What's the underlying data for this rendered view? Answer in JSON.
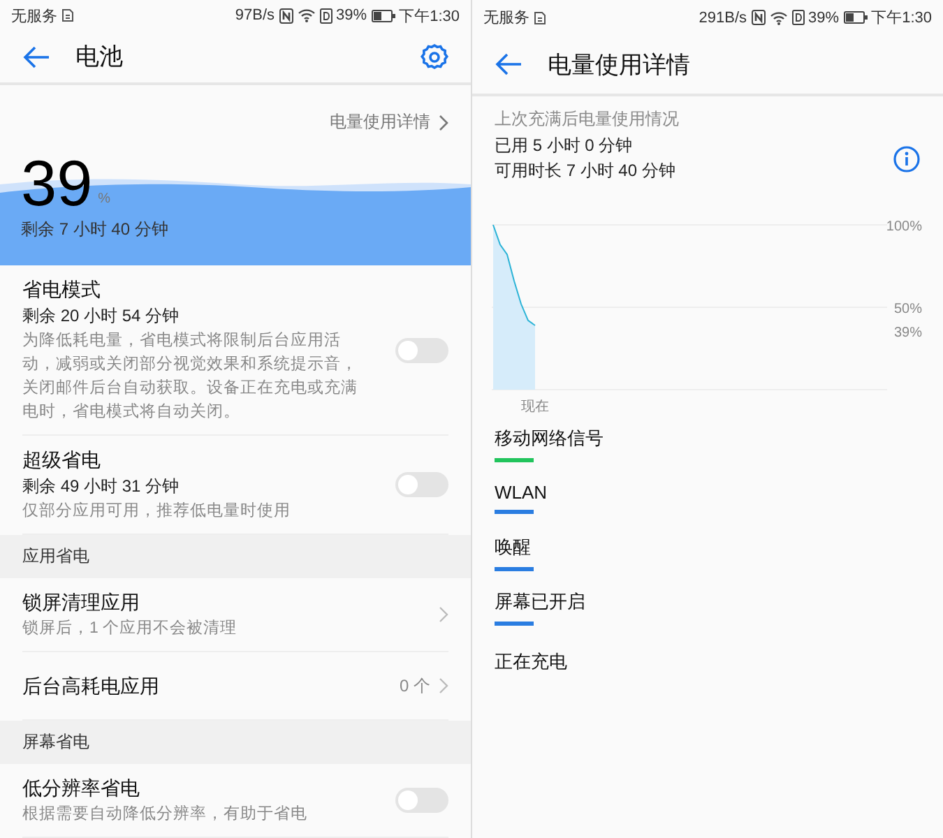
{
  "battery_screen": {
    "status_bar": {
      "carrier": "无服务",
      "speed": "97B/s",
      "battery": "39%",
      "time": "下午1:30"
    },
    "toolbar": {
      "title": "电池"
    },
    "summary": {
      "details_link": "电量使用详情",
      "percent": "39",
      "percent_unit": "%",
      "remaining": "剩余 7 小时 40 分钟"
    },
    "items": [
      {
        "kind": "toggle",
        "title": "省电模式",
        "info": "剩余 20 小时 54 分钟",
        "description": "为降低耗电量，省电模式将限制后台应用活动，减弱或关闭部分视觉效果和系统提示音，关闭邮件后台自动获取。设备正在充电或充满电时，省电模式将自动关闭。",
        "on": false
      },
      {
        "kind": "toggle",
        "title": "超级省电",
        "info": "剩余 49 小时 31 分钟",
        "description": "仅部分应用可用，推荐低电量时使用",
        "on": false
      },
      {
        "kind": "header",
        "title": "应用省电"
      },
      {
        "kind": "link",
        "title": "锁屏清理应用",
        "description": "锁屏后，1 个应用不会被清理"
      },
      {
        "kind": "link",
        "title": "后台高耗电应用",
        "value": "0 个"
      },
      {
        "kind": "header",
        "title": "屏幕省电"
      },
      {
        "kind": "toggle",
        "title": "低分辨率省电",
        "description": "根据需要自动降低分辨率，有助于省电",
        "on": false
      }
    ]
  },
  "details_screen": {
    "status_bar": {
      "carrier": "无服务",
      "speed": "291B/s",
      "battery": "39%",
      "time": "下午1:30"
    },
    "toolbar": {
      "title": "电量使用详情"
    },
    "caption": "上次充满后电量使用情况",
    "used": "已用 5 小时 0 分钟",
    "available": "可用时长 7 小时 40 分钟",
    "battery_graph": {
      "top_label": "100%",
      "middle_label": "50%",
      "current_label": "39%",
      "time_label": "现在"
    },
    "usage": [
      {
        "label": "移动网络信号",
        "color": "#21c45c"
      },
      {
        "label": "WLAN",
        "color": "#2a7de1"
      },
      {
        "label": "唤醒",
        "color": "#2a7de1"
      },
      {
        "label": "屏幕已开启",
        "color": "#2a7de1"
      },
      {
        "label": "正在充电"
      }
    ]
  }
}
